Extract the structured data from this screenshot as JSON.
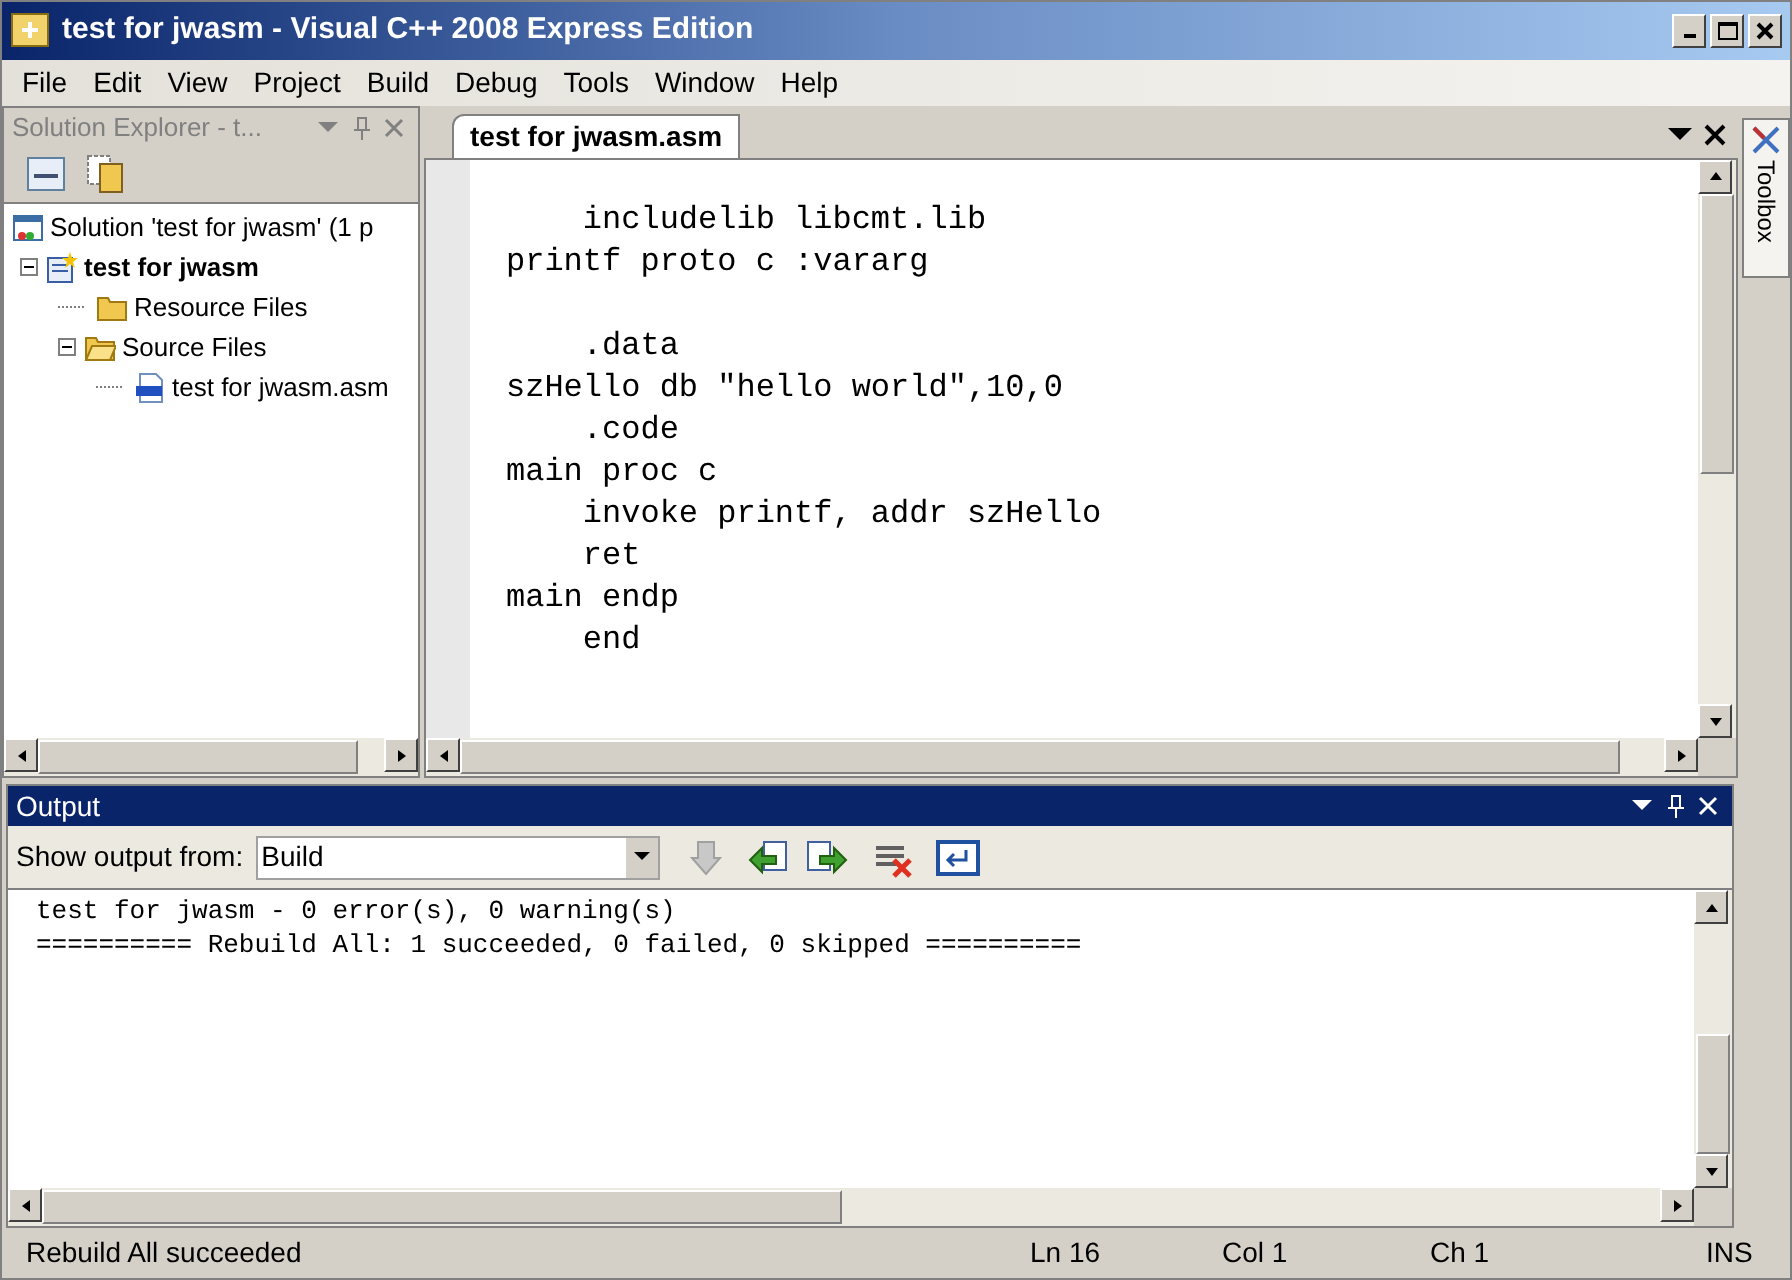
{
  "window": {
    "title": "test for jwasm - Visual C++ 2008 Express Edition"
  },
  "menu": [
    "File",
    "Edit",
    "View",
    "Project",
    "Build",
    "Debug",
    "Tools",
    "Window",
    "Help"
  ],
  "solution_explorer": {
    "title": "Solution Explorer - t...",
    "tree": [
      {
        "label": "Solution 'test for jwasm' (1 p",
        "kind": "solution",
        "children": [
          {
            "label": "test for jwasm",
            "kind": "project",
            "expanded": true,
            "children": [
              {
                "label": "Resource Files",
                "kind": "folder"
              },
              {
                "label": "Source Files",
                "kind": "folder",
                "expanded": true,
                "children": [
                  {
                    "label": "test for jwasm.asm",
                    "kind": "asm"
                  }
                ]
              }
            ]
          }
        ]
      }
    ]
  },
  "editor": {
    "tabs": [
      {
        "label": "test for jwasm.asm",
        "selected": true
      }
    ],
    "blocks": [
      [
        "    includelib libcmt.lib",
        "printf proto c :vararg"
      ],
      [
        "    .data",
        "szHello db \"hello world\",10,0",
        "    .code",
        "main proc c",
        "    invoke printf, addr szHello",
        "    ret",
        "main endp",
        "    end"
      ]
    ]
  },
  "toolbox": {
    "label": "Toolbox"
  },
  "output": {
    "title": "Output",
    "show_from_label": "Show output from:",
    "source": "Build",
    "lines": [
      "test for jwasm - 0 error(s), 0 warning(s)",
      "========== Rebuild All: 1 succeeded, 0 failed, 0 skipped =========="
    ]
  },
  "status_bar": {
    "message": "Rebuild All succeeded",
    "line": "Ln 16",
    "col": "Col 1",
    "ch": "Ch 1",
    "mode": "INS"
  }
}
